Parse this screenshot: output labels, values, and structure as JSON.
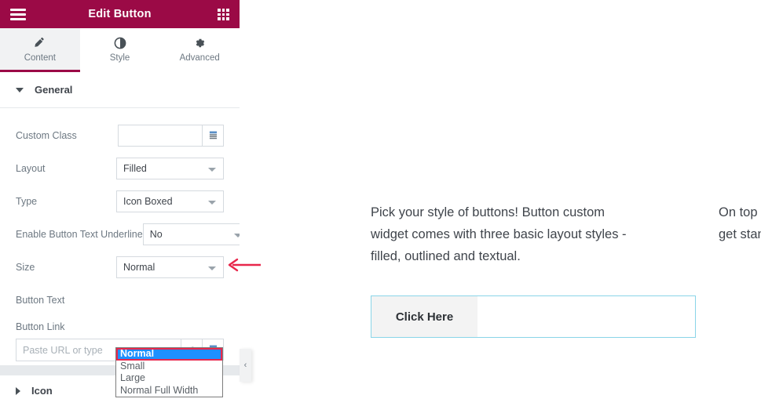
{
  "panel": {
    "header": {
      "title": "Edit Button",
      "menu_icon": "hamburger-menu-icon",
      "grid_icon": "widgets-grid-icon"
    },
    "tabs": [
      {
        "label": "Content",
        "icon": "pencil-icon",
        "active": true
      },
      {
        "label": "Style",
        "icon": "contrast-circle-icon",
        "active": false
      },
      {
        "label": "Advanced",
        "icon": "gear-icon",
        "active": false
      }
    ],
    "sections": [
      {
        "title": "General",
        "expanded": true
      },
      {
        "title": "Icon",
        "expanded": false
      }
    ],
    "fields": {
      "custom_class": {
        "label": "Custom Class",
        "value": "",
        "placeholder": "",
        "dynamic_icon": "dynamic-tags-icon"
      },
      "layout": {
        "label": "Layout",
        "value": "Filled"
      },
      "type": {
        "label": "Type",
        "value": "Icon Boxed"
      },
      "underline": {
        "label": "Enable Button Text Underline",
        "value": "No"
      },
      "size": {
        "label": "Size",
        "value": "Normal"
      },
      "button_text": {
        "label": "Button Text"
      },
      "button_link": {
        "label": "Button Link",
        "placeholder": "Paste URL or type",
        "value": "",
        "settings_icon": "gear-icon",
        "dynamic_icon": "dynamic-tags-icon"
      }
    },
    "size_dropdown": {
      "open": true,
      "options": [
        "Normal",
        "Small",
        "Large",
        "Normal Full Width"
      ],
      "selected": "Normal",
      "highlight_color": "#1e90ff",
      "highlight_border_color": "#e8274b"
    },
    "annotation": {
      "arrow": "left-pointing-arrow",
      "color": "#e8274b"
    },
    "collapse_handle": {
      "icon": "chevron-left-icon",
      "label": "‹"
    }
  },
  "canvas": {
    "paragraph_left": "Pick your style of buttons! Button custom widget comes with three basic layout styles - filled, outlined and textual.",
    "paragraph_right": "On top o also get standard",
    "button": {
      "label": "Click Here"
    }
  },
  "colors": {
    "brand": "#9b0a46",
    "tab_active_bg": "#f1f2f3",
    "panel_border": "#e6e9ec",
    "widget_outline": "#8ad5e8",
    "button_bg": "#f3f3f3"
  }
}
